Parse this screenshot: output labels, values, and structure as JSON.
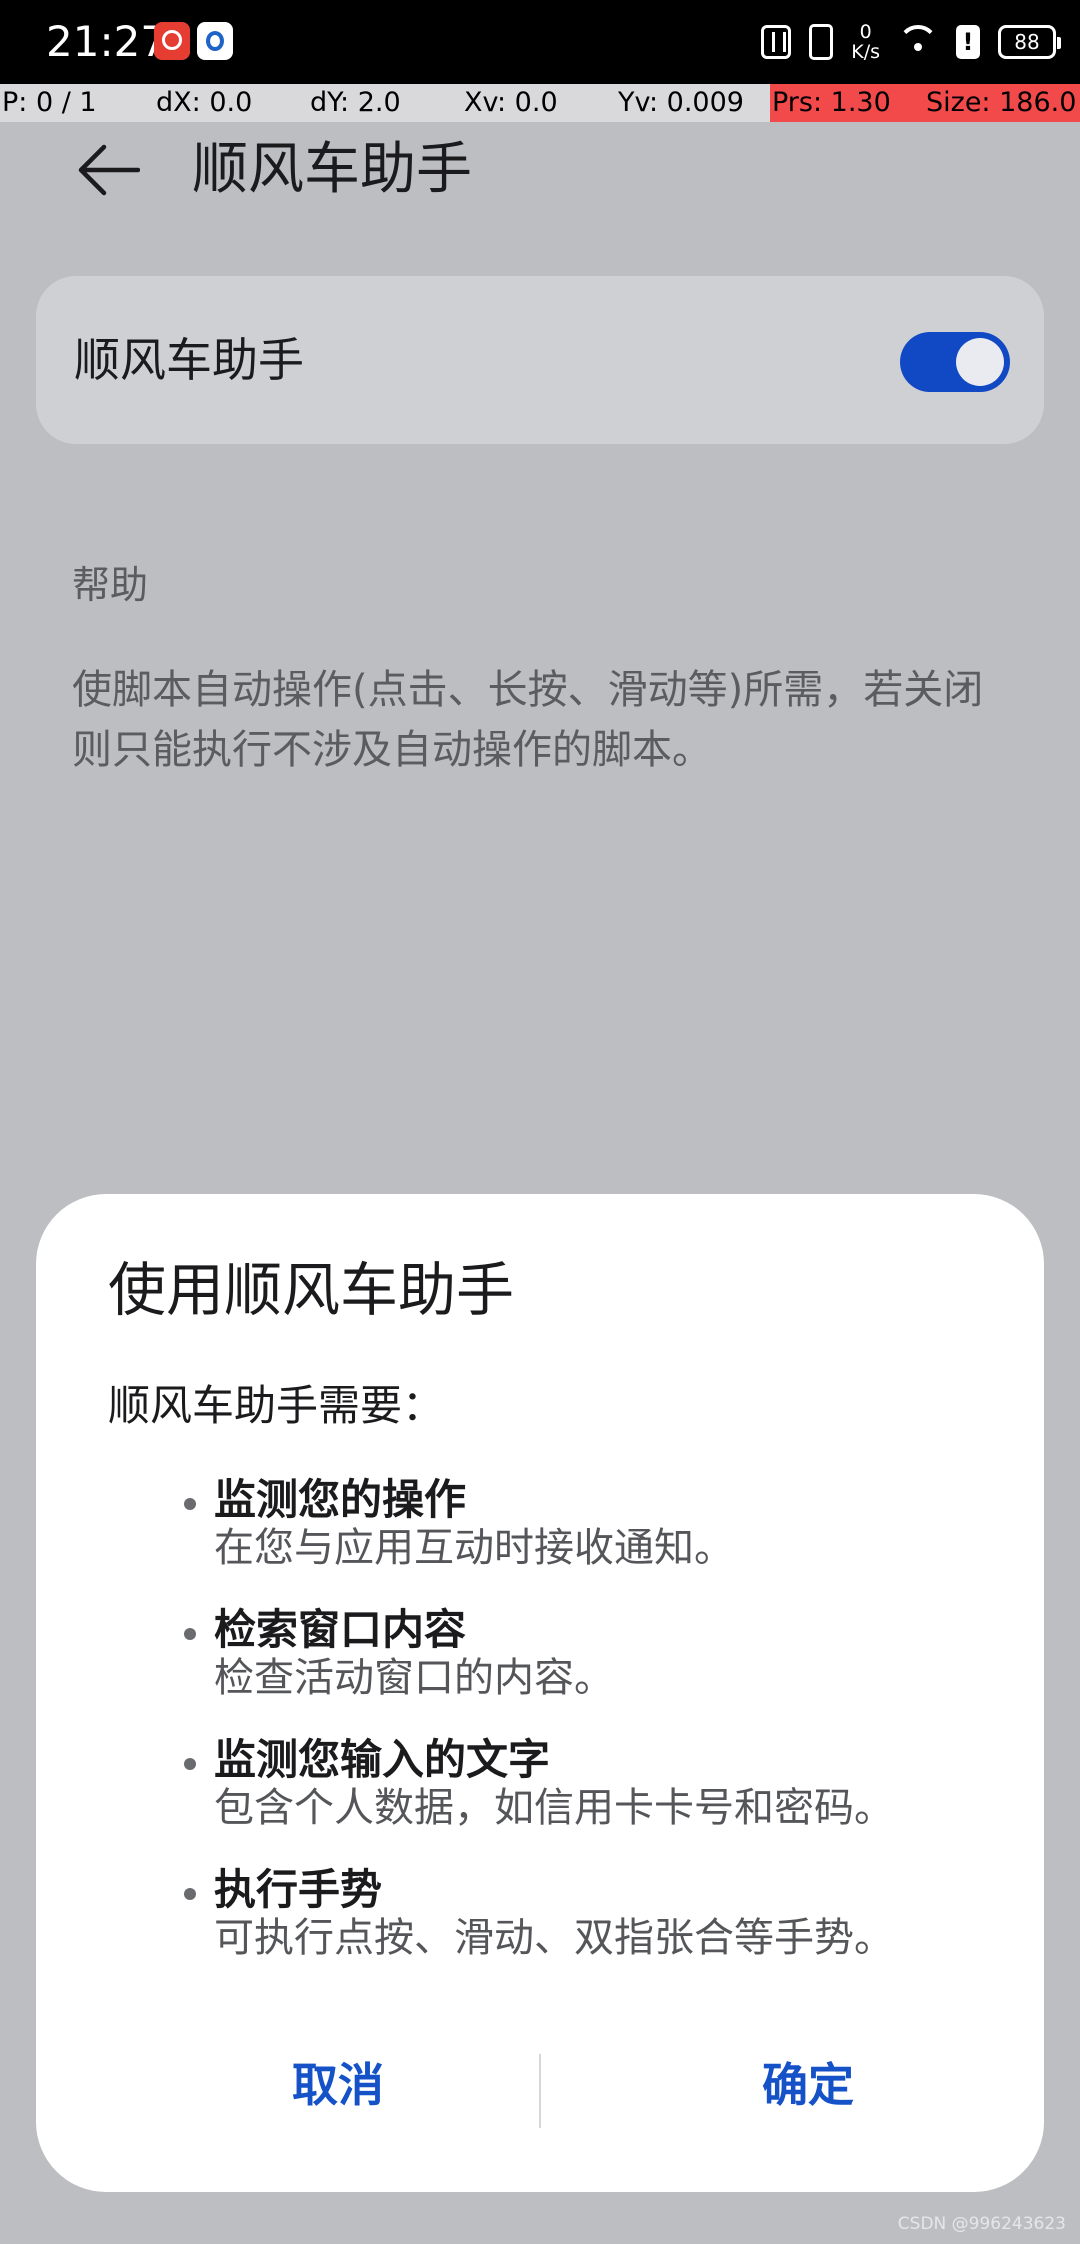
{
  "status_bar": {
    "time": "21:27",
    "speed_value": "0",
    "speed_unit": "K/s",
    "battery": "88",
    "icons": [
      "app-notification-icon",
      "app-notification-icon",
      "nfc-icon",
      "vibrate-icon",
      "wifi-icon",
      "alert-icon",
      "battery-icon"
    ]
  },
  "debug_bar": {
    "pointer": "P: 0 / 1",
    "dx": "dX: 0.0",
    "dy": "dY: 2.0",
    "xv": "Xv: 0.0",
    "yv": "Yv: 0.009",
    "prs": "Prs: 1.30",
    "size": "Size: 186.0"
  },
  "app_bar": {
    "title": "顺风车助手",
    "back_icon": "back-arrow-icon"
  },
  "service_card": {
    "label": "顺风车助手",
    "toggle_on": true
  },
  "help": {
    "title": "帮助",
    "text": "使脚本自动操作(点击、长按、滑动等)所需，若关闭则只能执行不涉及自动操作的脚本。"
  },
  "dialog": {
    "title": "使用顺风车助手",
    "intro": "顺风车助手需要：",
    "permissions": [
      {
        "title": "监测您的操作",
        "desc": "在您与应用互动时接收通知。"
      },
      {
        "title": "检索窗口内容",
        "desc": "检查活动窗口的内容。"
      },
      {
        "title": "监测您输入的文字",
        "desc": "包含个人数据，如信用卡卡号和密码。"
      },
      {
        "title": "执行手势",
        "desc": "可执行点按、滑动、双指张合等手势。"
      }
    ],
    "cancel_label": "取消",
    "confirm_label": "确定"
  },
  "watermark": "CSDN @996243623",
  "colors": {
    "accent": "#1552c8",
    "toggle_track": "#1148c4",
    "dim_background": "#bdbec1",
    "debug_highlight": "#f24a4a"
  }
}
